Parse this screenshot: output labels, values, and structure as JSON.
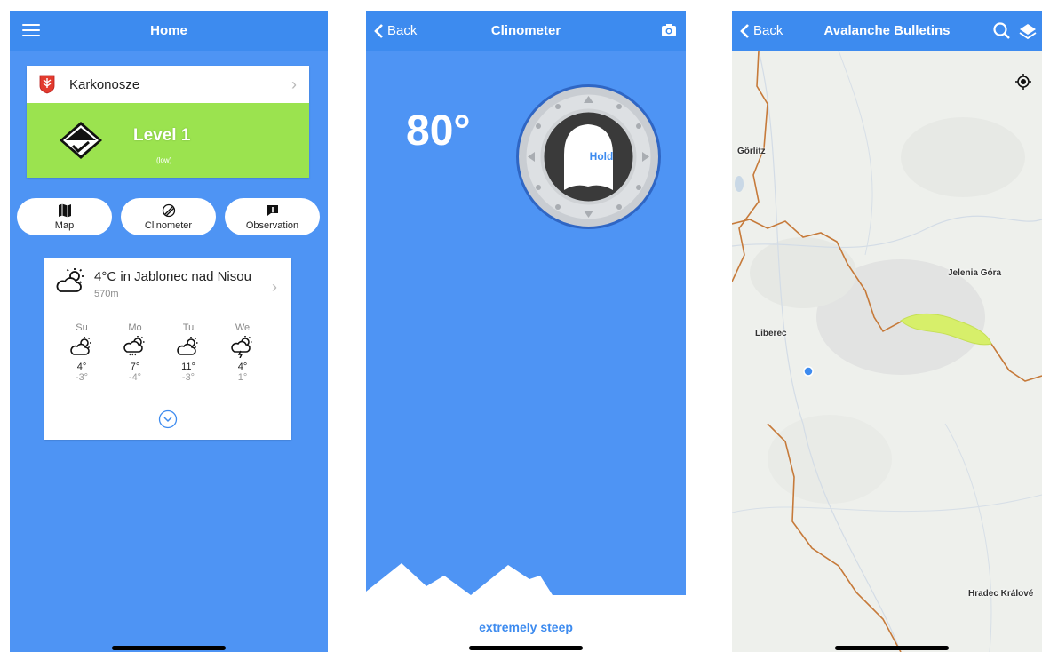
{
  "home": {
    "title": "Home",
    "region": {
      "name": "Karkonosze",
      "level_title": "Level 1",
      "level_sub": "(low)"
    },
    "buttons": [
      {
        "label": "Map"
      },
      {
        "label": "Clinometer"
      },
      {
        "label": "Observation"
      }
    ],
    "weather": {
      "title": "4°C in Jablonec nad Nisou",
      "elevation": "570m",
      "days": [
        {
          "name": "Su",
          "high": "4°",
          "low": "-3°",
          "icon": "sun-cloud-icon"
        },
        {
          "name": "Mo",
          "high": "7°",
          "low": "-4°",
          "icon": "sun-rain-icon"
        },
        {
          "name": "Tu",
          "high": "11°",
          "low": "-3°",
          "icon": "sun-cloud-icon"
        },
        {
          "name": "We",
          "high": "4°",
          "low": "1°",
          "icon": "storm-icon"
        }
      ]
    }
  },
  "clinometer": {
    "back": "Back",
    "title": "Clinometer",
    "angle": "80°",
    "hold": "Hold",
    "steepness": "extremely steep"
  },
  "bulletins": {
    "back": "Back",
    "title": "Avalanche Bulletins",
    "places": [
      "Görlitz",
      "Jelenia Góra",
      "Liberec",
      "Hradec Králové"
    ]
  },
  "colors": {
    "accent": "#3d8bef",
    "level1": "#9be34f",
    "highlight": "#d7ef6a",
    "border": "#c67a3a"
  }
}
